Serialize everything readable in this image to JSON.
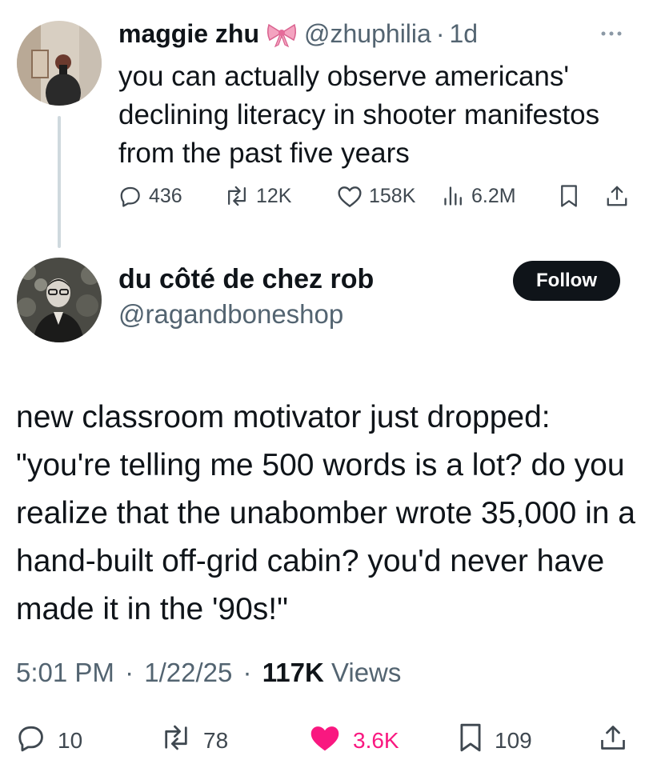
{
  "tweet1": {
    "display_name": "maggie zhu",
    "name_emoji": "bow-icon",
    "handle": "@zhuphilia",
    "separator": "·",
    "time": "1d",
    "more_icon": "more-icon",
    "text": "you can actually observe americans' declining literacy in shooter manifestos from the past five years",
    "actions": {
      "replies": "436",
      "reposts": "12K",
      "likes": "158K",
      "views": "6.2M"
    }
  },
  "tweet2": {
    "display_name": "du côté de chez rob",
    "handle": "@ragandboneshop",
    "follow_label": "Follow",
    "text": "new classroom motivator just dropped: \"you're telling me 500 words is a lot? do you realize that the unabomber wrote 35,000 in a hand-built off-grid cabin? you'd never have made it in the '90s!\"",
    "meta": {
      "time": "5:01 PM",
      "sep1": "·",
      "date": "1/22/25",
      "sep2": "·",
      "views_count": "117K",
      "views_label": "Views"
    },
    "actions": {
      "replies": "10",
      "reposts": "78",
      "likes": "3.6K",
      "bookmarks": "109"
    }
  },
  "colors": {
    "like_active": "#f91880",
    "text_primary": "#0f1419",
    "text_muted": "#536471",
    "thread_line": "#cfd9de"
  }
}
